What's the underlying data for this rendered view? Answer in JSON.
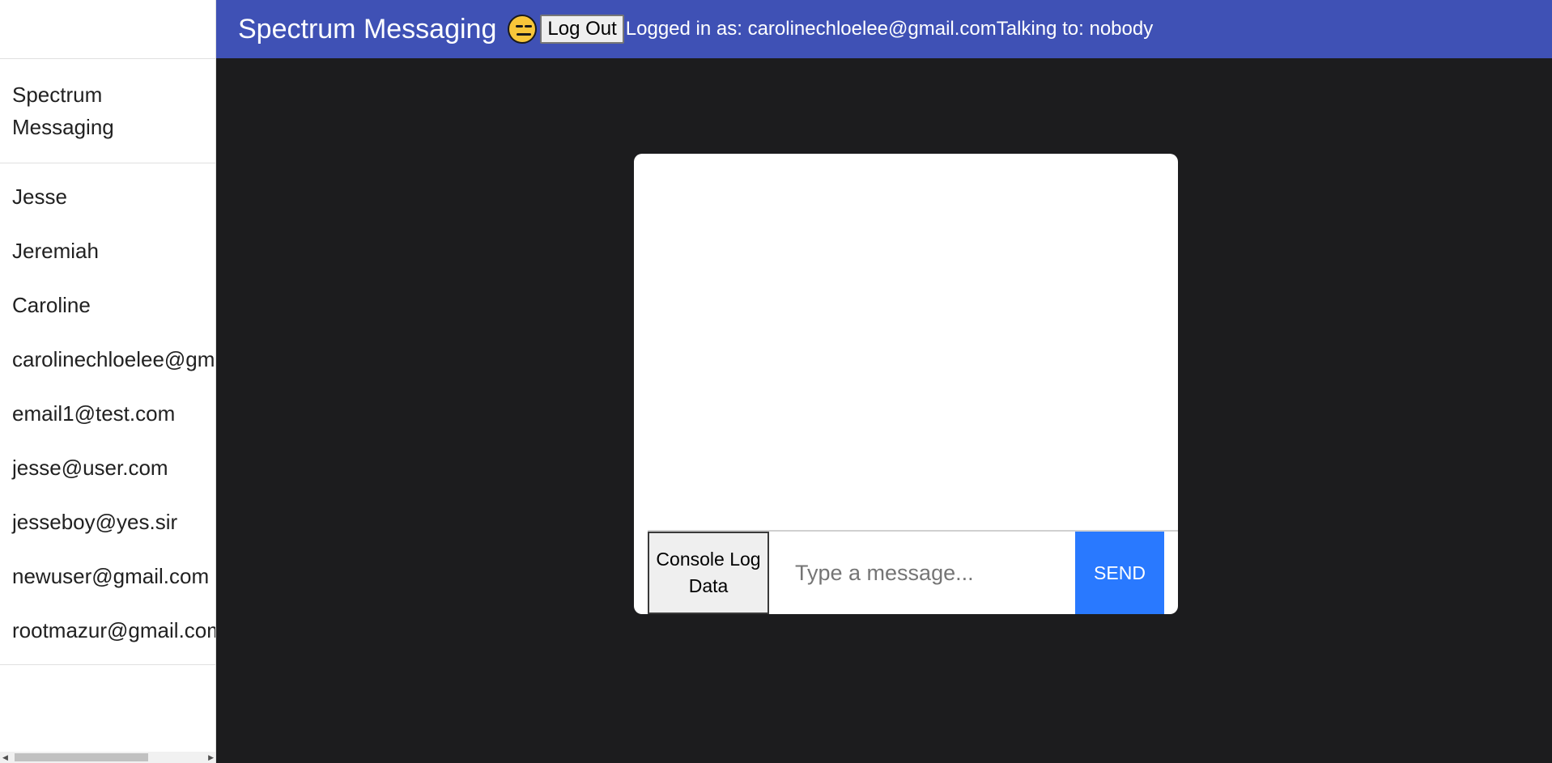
{
  "sidebar": {
    "brand": "Spectrum Messaging",
    "users": [
      {
        "label": "Jesse"
      },
      {
        "label": "Jeremiah"
      },
      {
        "label": "Caroline"
      },
      {
        "label": "carolinechloelee@gmail.com"
      },
      {
        "label": "email1@test.com"
      },
      {
        "label": "jesse@user.com"
      },
      {
        "label": "jesseboy@yes.sir"
      },
      {
        "label": "newuser@gmail.com"
      },
      {
        "label": "rootmazur@gmail.com"
      }
    ]
  },
  "appbar": {
    "title": "Spectrum Messaging",
    "emoji_icon": "expressionless-face-icon",
    "logout_label": "Log Out",
    "logged_in_text": "Logged in as: carolinechloelee@gmail.com",
    "talking_to_text": "Talking to: nobody"
  },
  "chat": {
    "console_button_label": "Console Log Data",
    "message_placeholder": "Type a message...",
    "message_value": "",
    "send_label": "SEND"
  },
  "colors": {
    "appbar": "#3f51b5",
    "send_button": "#2979ff",
    "background": "#1c1c1e"
  }
}
